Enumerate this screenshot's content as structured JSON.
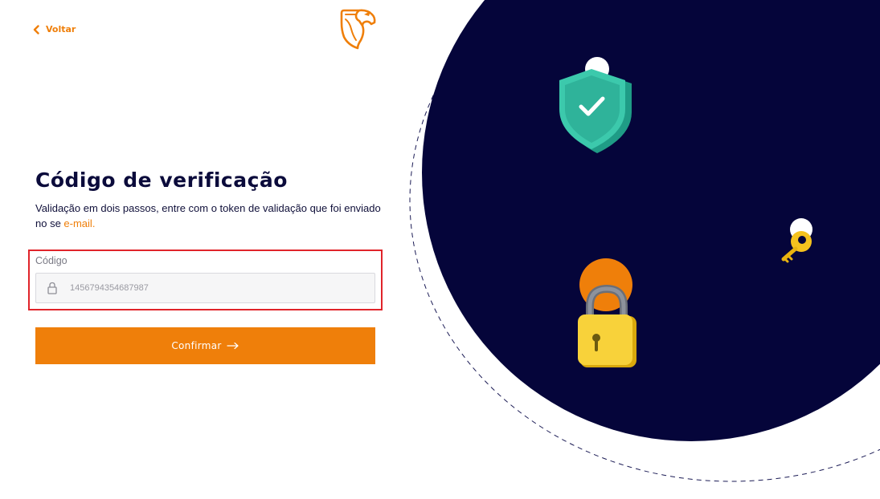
{
  "nav": {
    "back_label": "Voltar"
  },
  "brand": {
    "logo_icon": "horse-shield-logo-icon",
    "accent_color": "#ef7f0a"
  },
  "form": {
    "title": "Código de verificação",
    "description": "Validação em dois passos, entre com o token de validação que foi enviado no se ",
    "description_link": "e-mail.",
    "code_label": "Código",
    "code_value": "1456794354687987",
    "confirm_label": "Confirmar",
    "confirm_icon": "arrow-right-icon"
  },
  "illustration": {
    "background_color": "#05053a",
    "icons": [
      "shield-check-icon",
      "key-icon",
      "padlock-icon"
    ]
  }
}
